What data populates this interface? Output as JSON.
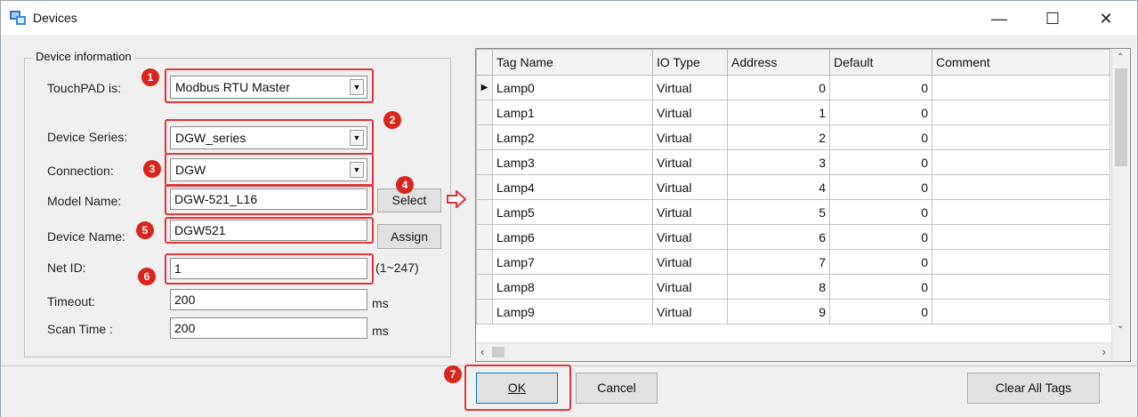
{
  "window": {
    "title": "Devices",
    "minimize": "—",
    "maximize": "☐",
    "close": "✕"
  },
  "device_info": {
    "legend": "Device information",
    "touchpad_label": "TouchPAD is:",
    "touchpad_value": "Modbus RTU Master",
    "series_label": "Device Series:",
    "series_value": "DGW_series",
    "connection_label": "Connection:",
    "connection_value": "DGW",
    "model_label": "Model Name:",
    "model_value": "DGW-521_L16",
    "select_button": "Select",
    "device_name_label": "Device Name:",
    "device_name_value": "DGW521",
    "assign_button": "Assign",
    "netid_label": "Net ID:",
    "netid_value": "1",
    "netid_range": "(1~247)",
    "timeout_label": "Timeout:",
    "timeout_value": "200",
    "timeout_unit": "ms",
    "scantime_label": "Scan Time :",
    "scantime_value": "200",
    "scantime_unit": "ms"
  },
  "badges": [
    "1",
    "2",
    "3",
    "4",
    "5",
    "6",
    "7"
  ],
  "tags_table": {
    "columns": [
      "Tag Name",
      "IO Type",
      "Address",
      "Default",
      "Comment"
    ],
    "rows": [
      [
        "Lamp0",
        "Virtual",
        "0",
        "0",
        ""
      ],
      [
        "Lamp1",
        "Virtual",
        "1",
        "0",
        ""
      ],
      [
        "Lamp2",
        "Virtual",
        "2",
        "0",
        ""
      ],
      [
        "Lamp3",
        "Virtual",
        "3",
        "0",
        ""
      ],
      [
        "Lamp4",
        "Virtual",
        "4",
        "0",
        ""
      ],
      [
        "Lamp5",
        "Virtual",
        "5",
        "0",
        ""
      ],
      [
        "Lamp6",
        "Virtual",
        "6",
        "0",
        ""
      ],
      [
        "Lamp7",
        "Virtual",
        "7",
        "0",
        ""
      ],
      [
        "Lamp8",
        "Virtual",
        "8",
        "0",
        ""
      ],
      [
        "Lamp9",
        "Virtual",
        "9",
        "0",
        ""
      ]
    ]
  },
  "footer": {
    "ok": "OK",
    "cancel": "Cancel",
    "clear_all_tags": "Clear All Tags"
  },
  "colors": {
    "highlight": "#e0353b",
    "badge": "#d7261e"
  }
}
